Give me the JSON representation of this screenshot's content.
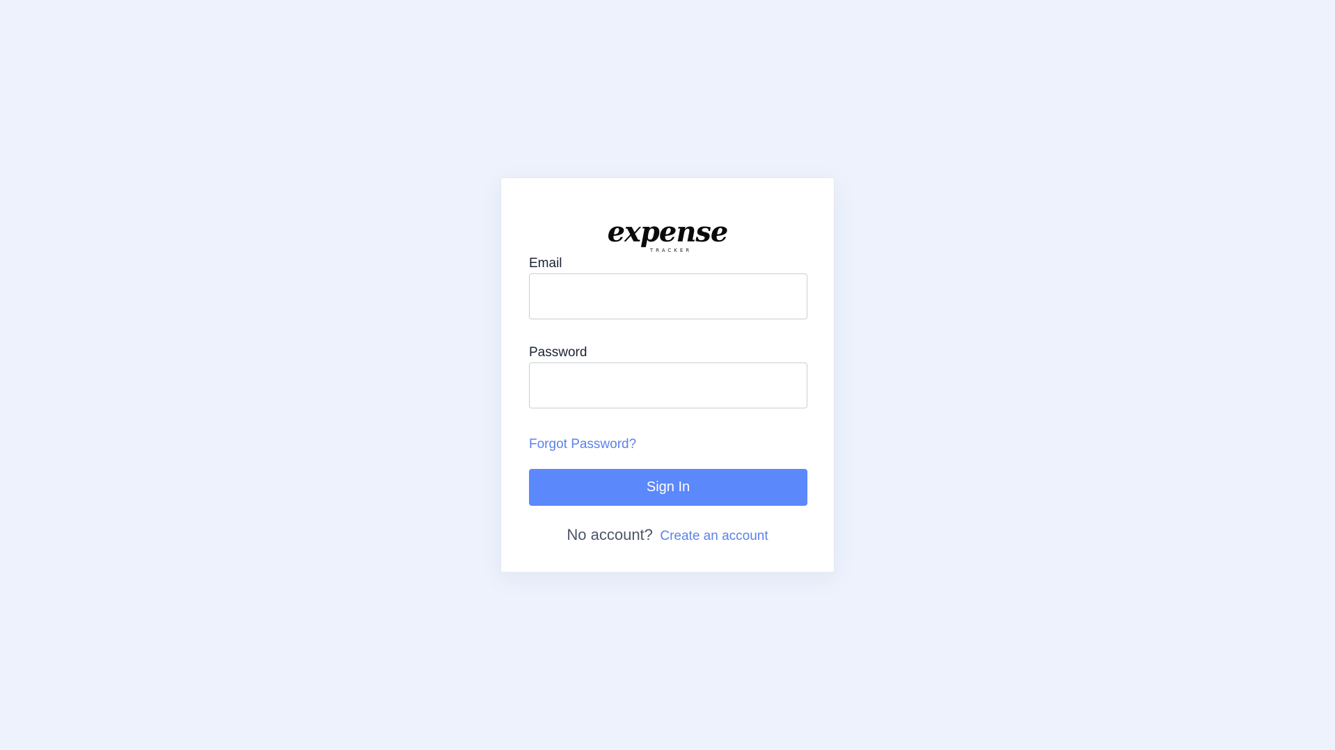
{
  "logo": {
    "word": "expense",
    "sub": "TRACKER"
  },
  "form": {
    "email_label": "Email",
    "email_value": "",
    "email_placeholder": "",
    "password_label": "Password",
    "password_value": "",
    "password_placeholder": "",
    "forgot_label": "Forgot Password?",
    "signin_label": "Sign In"
  },
  "footer": {
    "prompt": "No account?",
    "create_label": "Create an account"
  },
  "colors": {
    "background": "#edf2fc",
    "accent": "#5b88fb",
    "link": "#5b82e8"
  }
}
